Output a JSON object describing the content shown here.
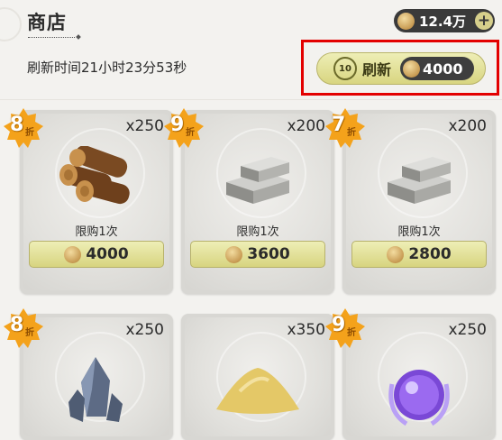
{
  "header": {
    "title": "商店",
    "currency_amount": "12.4万",
    "plus_icon": "plus-icon",
    "coin_icon": "coin-icon",
    "refresh_timer": "刷新时间21小时23分53秒",
    "refresh": {
      "icon_label": "10",
      "label": "刷新",
      "price": "4000"
    }
  },
  "colors": {
    "highlight": "#e30000",
    "button": "#e3e09d",
    "badge": "#f4a21b"
  },
  "items": [
    {
      "discount": "8",
      "discount_suffix": "折",
      "quantity": "x250",
      "icon": "wood-logs-icon",
      "limit": "限购1次",
      "price": "4000"
    },
    {
      "discount": "9",
      "discount_suffix": "折",
      "quantity": "x200",
      "icon": "stone-bricks-icon",
      "limit": "限购1次",
      "price": "3600"
    },
    {
      "discount": "7",
      "discount_suffix": "折",
      "quantity": "x200",
      "icon": "stone-bricks-icon",
      "limit": "限购1次",
      "price": "2800"
    },
    {
      "discount": "8",
      "discount_suffix": "折",
      "quantity": "x250",
      "icon": "crystal-ore-icon"
    },
    {
      "discount": "",
      "quantity": "x350",
      "icon": "sand-pile-icon"
    },
    {
      "discount": "9",
      "discount_suffix": "折",
      "quantity": "x250",
      "icon": "purple-orb-icon"
    }
  ]
}
